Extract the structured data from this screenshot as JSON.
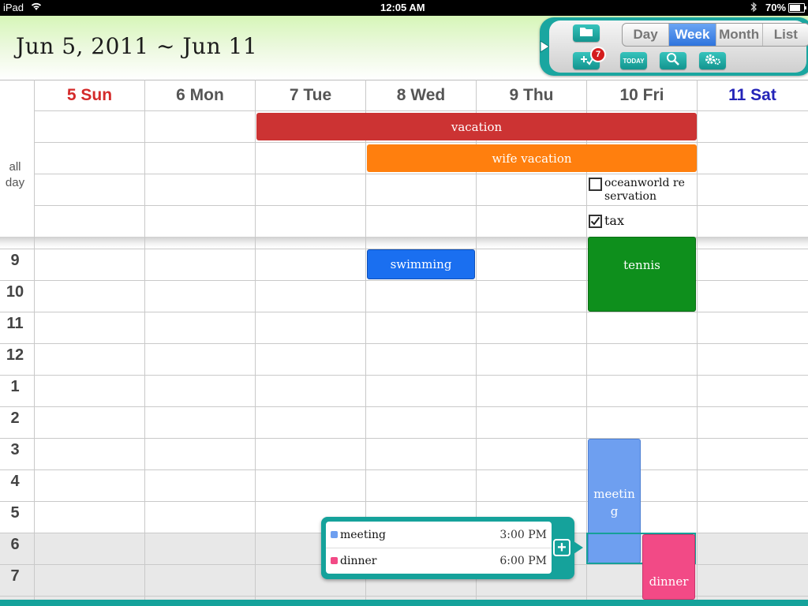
{
  "status_bar": {
    "device": "iPad",
    "time": "12:05 AM",
    "battery": "70%",
    "icons": [
      "wifi-icon",
      "bluetooth-icon",
      "battery-icon"
    ]
  },
  "header": {
    "date_range": "Jun 5, 2011 ~ Jun 11"
  },
  "toolbar": {
    "views": [
      {
        "label": "Day",
        "active": false
      },
      {
        "label": "Week",
        "active": true
      },
      {
        "label": "Month",
        "active": false
      },
      {
        "label": "List",
        "active": false
      }
    ],
    "todo_badge": "7",
    "today_label": "TODAY",
    "icons": [
      "folder-icon",
      "add-todo-icon",
      "search-icon",
      "settings-icon",
      "expand-arrow-icon"
    ]
  },
  "week": {
    "days": [
      {
        "label": "5 Sun",
        "color": "#d42a2a"
      },
      {
        "label": "6 Mon",
        "color": "#555555"
      },
      {
        "label": "7 Tue",
        "color": "#555555"
      },
      {
        "label": "8 Wed",
        "color": "#555555"
      },
      {
        "label": "9 Thu",
        "color": "#555555"
      },
      {
        "label": "10 Fri",
        "color": "#555555"
      },
      {
        "label": "11 Sat",
        "color": "#2424b8"
      }
    ],
    "all_day_label": "all\nday",
    "hours": [
      "9",
      "10",
      "11",
      "12",
      "1",
      "2",
      "3",
      "4",
      "5",
      "6",
      "7"
    ]
  },
  "all_day_events": [
    {
      "title": "vacation",
      "color": "#cc3333"
    },
    {
      "title": "wife vacation",
      "color": "#ff7f0e"
    }
  ],
  "todos": [
    {
      "title": "oceanworld re servation",
      "line1": "oceanworld re",
      "line2": "servation",
      "checked": false
    },
    {
      "title": "tax",
      "checked": true
    }
  ],
  "timed_events": [
    {
      "title": "swimming",
      "color": "#1a6ff0"
    },
    {
      "title": "tennis",
      "color": "#0e8f1c"
    },
    {
      "title": "meeting",
      "line1": "meetin",
      "line2": "g",
      "color": "#6e9ff0"
    },
    {
      "title": "dinner",
      "color": "#f24a86"
    }
  ],
  "popup": {
    "items": [
      {
        "title": "meeting",
        "time": "3:00 PM",
        "color": "#6e9ff0"
      },
      {
        "title": "dinner",
        "time": "6:00 PM",
        "color": "#f24a86"
      }
    ],
    "add_label": "+"
  }
}
